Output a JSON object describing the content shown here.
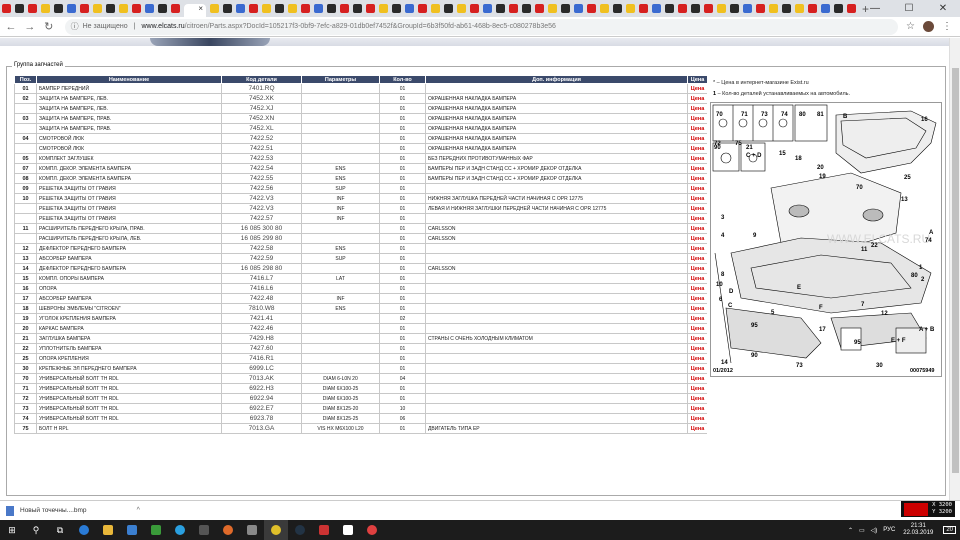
{
  "browser": {
    "active_tab_close": "×",
    "new_tab": "+",
    "window_controls": [
      "—",
      "☐",
      "✕"
    ],
    "security_label": "Не защищено",
    "url_domain": "www.elcats.ru",
    "url_path": "/citroen/Parts.aspx?DocId=105217f3-0bf9-7efc-a829-01db0ef7452f&GroupId=6b3f50fd-ab61-468b-8ec5-c080278b3e56"
  },
  "group_title": "Группа запчастей",
  "table": {
    "headers": [
      "Поз.",
      "Наименование",
      "Код детали",
      "Параметры",
      "Кол-во",
      "Доп. информация",
      "Цена"
    ],
    "price_label": "Цена",
    "rows": [
      {
        "pos": "01",
        "name": "БАМПЕР ПЕРЕДНИЙ",
        "code": "7401.RQ",
        "param": "",
        "qty": "01",
        "info": ""
      },
      {
        "pos": "02",
        "name": "ЗАЩИТА НА БАМПЕРЕ, ЛЕВ.",
        "code": "7452.XK",
        "param": "",
        "qty": "01",
        "info": "ОКРАШЕННАЯ НАКЛАДКА БАМПЕРА"
      },
      {
        "pos": "",
        "name": "ЗАЩИТА НА БАМПЕРЕ, ЛЕВ.",
        "code": "7452.XJ",
        "param": "",
        "qty": "01",
        "info": "ОКРАШЕННАЯ НАКЛАДКА БАМПЕРА"
      },
      {
        "pos": "03",
        "name": "ЗАЩИТА НА БАМПЕРЕ, ПРАВ.",
        "code": "7452.XN",
        "param": "",
        "qty": "01",
        "info": "ОКРАШЕННАЯ НАКЛАДКА БАМПЕРА"
      },
      {
        "pos": "",
        "name": "ЗАЩИТА НА БАМПЕРЕ, ПРАВ.",
        "code": "7452.XL",
        "param": "",
        "qty": "01",
        "info": "ОКРАШЕННАЯ НАКЛАДКА БАМПЕРА"
      },
      {
        "pos": "04",
        "name": "СМОТРОВОЙ ЛЮК",
        "code": "7422.52",
        "param": "",
        "qty": "01",
        "info": "ОКРАШЕННАЯ НАКЛАДКА БАМПЕРА"
      },
      {
        "pos": "",
        "name": "СМОТРОВОЙ ЛЮК",
        "code": "7422.51",
        "param": "",
        "qty": "01",
        "info": "ОКРАШЕННАЯ НАКЛАДКА БАМПЕРА"
      },
      {
        "pos": "05",
        "name": "КОМПЛЕКТ ЗАГЛУШЕК",
        "code": "7422.53",
        "param": "",
        "qty": "01",
        "info": "БЕЗ ПЕРЕДНИХ ПРОТИВОТУМАННЫХ ФАР"
      },
      {
        "pos": "07",
        "name": "КОМПЛ. ДЕКОР. ЭЛЕМЕНТА БАМПЕРА",
        "code": "7422.54",
        "param": "ENS",
        "qty": "01",
        "info": "БАМПЕРЫ ПЕР И ЗАДН СТАНД CC + ХРОМИР ДЕКОР ОТДЕЛКА"
      },
      {
        "pos": "08",
        "name": "КОМПЛ. ДЕКОР. ЭЛЕМЕНТА БАМПЕРА",
        "code": "7422.55",
        "param": "ENS",
        "qty": "01",
        "info": "БАМПЕРЫ ПЕР И ЗАДН СТАНД CC + ХРОМИР ДЕКОР ОТДЕЛКА"
      },
      {
        "pos": "09",
        "name": "РЕШЕТКА ЗАЩИТЫ ОТ ГРАВИЯ",
        "code": "7422.56",
        "param": "SUP",
        "qty": "01",
        "info": ""
      },
      {
        "pos": "10",
        "name": "РЕШЕТКА ЗАЩИТЫ ОТ ГРАВИЯ",
        "code": "7422.V3",
        "param": "INF",
        "qty": "01",
        "info": "НИЖНЯЯ ЗАГЛУШКА ПЕРЕДНЕЙ ЧАСТИ НАЧИНАЯ С OPR 12775"
      },
      {
        "pos": "",
        "name": "РЕШЕТКА ЗАЩИТЫ ОТ ГРАВИЯ",
        "code": "7422.V3",
        "param": "INF",
        "qty": "01",
        "info": "ЛЕВАЯ И НИЖНЯЯ ЗАГЛУШКИ ПЕРЕДНЕЙ ЧАСТИ НАЧИНАЯ С OPR 12775"
      },
      {
        "pos": "",
        "name": "РЕШЕТКА ЗАЩИТЫ ОТ ГРАВИЯ",
        "code": "7422.57",
        "param": "INF",
        "qty": "01",
        "info": ""
      },
      {
        "pos": "11",
        "name": "РАСШИРИТЕЛЬ ПЕРЕДНЕГО КРЫЛА, ПРАВ.",
        "code": "16 085 300 80",
        "param": "",
        "qty": "01",
        "info": "CARLSSON"
      },
      {
        "pos": "",
        "name": "РАСШИРИТЕЛЬ ПЕРЕДНЕГО КРЫЛА, ЛЕВ.",
        "code": "16 085 299 80",
        "param": "",
        "qty": "01",
        "info": "CARLSSON"
      },
      {
        "pos": "12",
        "name": "ДЕФЛЕКТОР ПЕРЕДНЕГО БАМПЕРА",
        "code": "7422.58",
        "param": "ENS",
        "qty": "01",
        "info": ""
      },
      {
        "pos": "13",
        "name": "АБСОРБЕР БАМПЕРА",
        "code": "7422.59",
        "param": "SUP",
        "qty": "01",
        "info": ""
      },
      {
        "pos": "14",
        "name": "ДЕФЛЕКТОР ПЕРЕДНЕГО БАМПЕРА",
        "code": "16 085 298 80",
        "param": "",
        "qty": "01",
        "info": "CARLSSON"
      },
      {
        "pos": "15",
        "name": "КОМПЛ. ОПОРЫ БАМПЕРА",
        "code": "7416.L7",
        "param": "LAT",
        "qty": "01",
        "info": ""
      },
      {
        "pos": "16",
        "name": "ОПОРА",
        "code": "7416.L6",
        "param": "",
        "qty": "01",
        "info": ""
      },
      {
        "pos": "17",
        "name": "АБСОРБЕР БАМПЕРА",
        "code": "7422.48",
        "param": "INF",
        "qty": "01",
        "info": ""
      },
      {
        "pos": "18",
        "name": "ШЕВРОНЫ ЭМБЛЕМЫ \"CITROEN\"",
        "code": "7810.W8",
        "param": "ENS",
        "qty": "01",
        "info": ""
      },
      {
        "pos": "19",
        "name": "УГОЛОК КРЕПЛЕНИЯ БАМПЕРА",
        "code": "7421.41",
        "param": "",
        "qty": "02",
        "info": ""
      },
      {
        "pos": "20",
        "name": "КАРКАС БАМПЕРА",
        "code": "7422.46",
        "param": "",
        "qty": "01",
        "info": ""
      },
      {
        "pos": "21",
        "name": "ЗАГЛУШКА БАМПЕРА",
        "code": "7429.H8",
        "param": "",
        "qty": "01",
        "info": "СТРАНЫ С ОЧЕНЬ ХОЛОДНЫМ КЛИМАТОМ"
      },
      {
        "pos": "22",
        "name": "УПЛОТНИТЕЛЬ БАМПЕРА",
        "code": "7427.60",
        "param": "",
        "qty": "01",
        "info": ""
      },
      {
        "pos": "25",
        "name": "ОПОРА КРЕПЛЕНИЯ",
        "code": "7416.R1",
        "param": "",
        "qty": "01",
        "info": ""
      },
      {
        "pos": "30",
        "name": "КРЕПЕЖНЫЕ ЭЛ ПЕРЕДНЕГО БАМПЕРА",
        "code": "6999.LC",
        "param": "",
        "qty": "01",
        "info": ""
      },
      {
        "pos": "70",
        "name": "УНИВЕРСАЛЬНЫЙ БОЛТ TH RDL",
        "code": "7013.AK",
        "param": "DIAM 6-L0N 20",
        "qty": "04",
        "info": ""
      },
      {
        "pos": "71",
        "name": "УНИВЕРСАЛЬНЫЙ БОЛТ TH RDL",
        "code": "6922.H3",
        "param": "DIAM 6X100-25",
        "qty": "01",
        "info": ""
      },
      {
        "pos": "72",
        "name": "УНИВЕРСАЛЬНЫЙ БОЛТ TH RDL",
        "code": "6922.94",
        "param": "DIAM 6X100-25",
        "qty": "01",
        "info": ""
      },
      {
        "pos": "73",
        "name": "УНИВЕРСАЛЬНЫЙ БОЛТ TH RDL",
        "code": "6922.E7",
        "param": "DIAM 8X125-20",
        "qty": "10",
        "info": ""
      },
      {
        "pos": "74",
        "name": "УНИВЕРСАЛЬНЫЙ БОЛТ TH RDL",
        "code": "6923.78",
        "param": "DIAM 8X125-25",
        "qty": "06",
        "info": ""
      },
      {
        "pos": "75",
        "name": "БОЛТ H RPL",
        "code": "7013.GA",
        "param": "VIS HX M6X100 L20",
        "qty": "01",
        "info": "ДВИГАТЕЛЬ ТИПА EP"
      }
    ]
  },
  "legend": {
    "price_note": "– Цена в интернет-магазине Exist.ru",
    "qty_note": "– Кол-во деталей устанавливаемых на автомобиль."
  },
  "diagram": {
    "date_label": "01/2012",
    "ref_label": "00075949",
    "watermark": "WWW.ELCATS.RU",
    "callouts": [
      "70",
      "71",
      "73",
      "74",
      "80",
      "81",
      "72",
      "75",
      "90",
      "21",
      "C + D",
      "B",
      "16",
      "15",
      "18",
      "19",
      "20",
      "70",
      "22",
      "11",
      "25",
      "13",
      "A",
      "74",
      "3",
      "9",
      "4",
      "8",
      "10",
      "D",
      "6",
      "C",
      "1",
      "80",
      "2",
      "5",
      "17",
      "95",
      "E + F",
      "A + B",
      "14",
      "90",
      "73",
      "30",
      "95",
      "12",
      "F",
      "E",
      "7"
    ]
  },
  "downloads": {
    "file_name": "Новый точечны....bmp",
    "caret": "^"
  },
  "overlay": {
    "x": "X 3200",
    "y": "Y 3200"
  },
  "taskbar": {
    "lang": "РУС",
    "time": "21:31",
    "date": "22.03.2019",
    "notif_count": "20"
  }
}
